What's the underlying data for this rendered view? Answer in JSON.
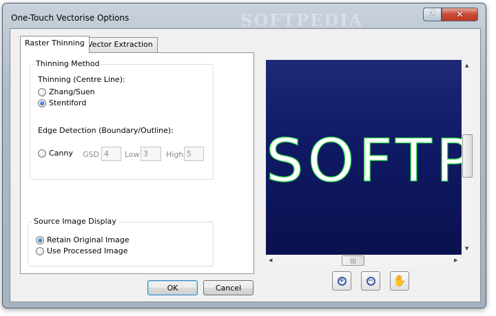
{
  "window": {
    "title": "One-Touch Vectorise Options",
    "watermark": "SOFTPEDIA",
    "help_label": "?",
    "close_label": "✕"
  },
  "tabs": [
    {
      "label": "Raster Thinning",
      "active": true
    },
    {
      "label": "Vector Extraction",
      "active": false
    }
  ],
  "thinning": {
    "group_label": "Thinning Method",
    "centre_line_label": "Thinning (Centre Line):",
    "options": [
      {
        "label": "Zhang/Suen",
        "checked": false
      },
      {
        "label": "Stentiford",
        "checked": true
      }
    ],
    "edge_label": "Edge Detection (Boundary/Outline):",
    "canny": {
      "label": "Canny",
      "checked": false
    },
    "gsd": {
      "label": "GSD",
      "value": "4"
    },
    "low": {
      "label": "Low",
      "value": "3"
    },
    "high": {
      "label": "High",
      "value": "5"
    }
  },
  "source": {
    "group_label": "Source Image Display",
    "options": [
      {
        "label": "Retain Original Image",
        "checked": true
      },
      {
        "label": "Use Processed Image",
        "checked": false
      }
    ]
  },
  "buttons": {
    "ok": "OK",
    "cancel": "Cancel"
  },
  "preview": {
    "text": "SOFTP",
    "background_color": "#0d1660",
    "outline_color": "#2fe04a"
  },
  "scroll": {
    "h_thumb_glyph": "|||"
  },
  "tools": {
    "zoom_in": "+",
    "zoom_out": "−",
    "pan": "✋"
  }
}
